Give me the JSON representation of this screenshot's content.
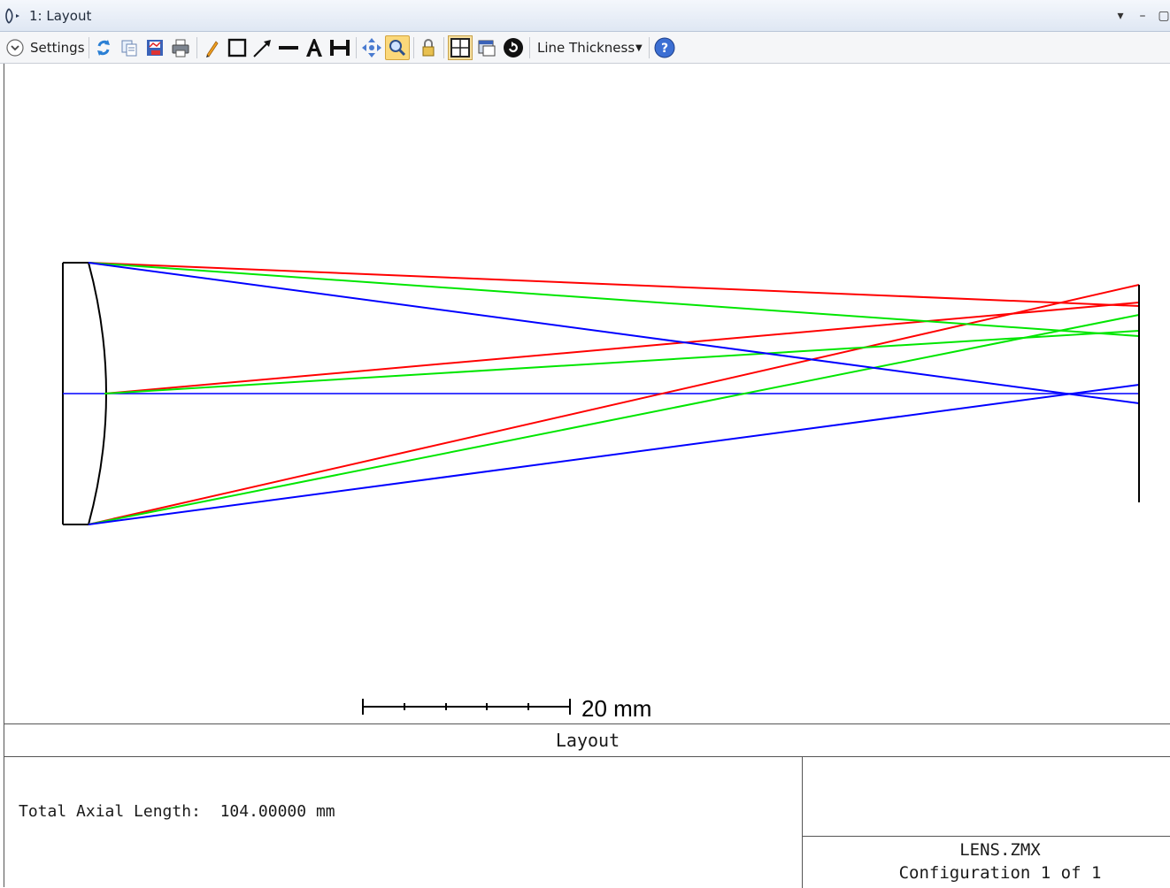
{
  "window": {
    "title": "1: Layout",
    "icon": "lens-icon",
    "controls": [
      "dropdown-arrow-icon",
      "minimize-icon",
      "maximize-icon"
    ]
  },
  "toolbar": {
    "settings_label": "Settings",
    "line_thickness_label": "Line Thickness",
    "icons": [
      "settings-chevron-icon",
      "refresh-icon",
      "copy-icon",
      "save-image-icon",
      "print-icon",
      "pencil-icon",
      "rectangle-icon",
      "arrow-line-icon",
      "line-icon",
      "text-icon",
      "dimension-icon",
      "pan-icon",
      "zoom-icon",
      "lock-icon",
      "fit-window-icon",
      "window-icon",
      "rotate-icon",
      "help-icon"
    ]
  },
  "plot": {
    "scale_bar_label": "20 mm",
    "colors": {
      "red": "#ff0000",
      "green": "#00e600",
      "blue": "#0000ff",
      "outline": "#000000"
    }
  },
  "footer": {
    "title": "Layout",
    "info": "Total Axial Length:  104.00000 mm",
    "file": "LENS.ZMX",
    "configuration": "Configuration 1 of 1"
  }
}
